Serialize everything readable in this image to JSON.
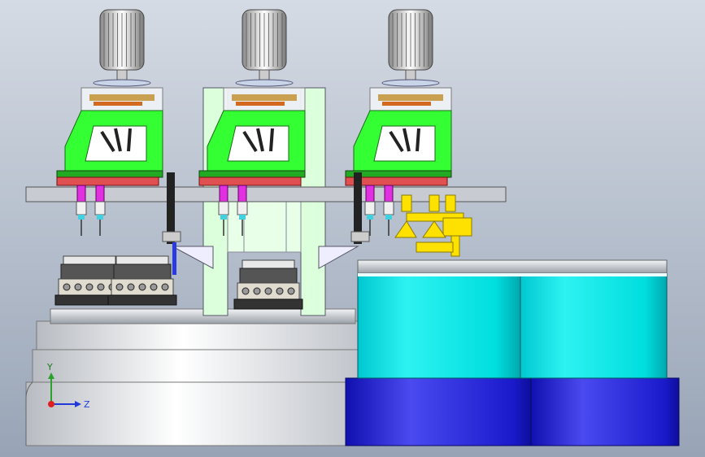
{
  "viewport": {
    "background_top": "#d5dbe4",
    "background_bottom": "#98a4b6"
  },
  "colors": {
    "frame_green": "#33ff33",
    "frame_light_green": "#dcffdc",
    "flange_red": "#e05050",
    "blue_cylinder": "#1a1acc",
    "cyan_drum": "#00e6e6",
    "yellow_fixture": "#ffe100",
    "magenta_spindle": "#e030e0",
    "grey_metal": "#c8ccd2"
  },
  "heads": [
    {
      "name": "drill-head-left"
    },
    {
      "name": "drill-head-center"
    },
    {
      "name": "drill-head-right"
    }
  ],
  "triad": {
    "y_label": "Y",
    "z_label": "Z"
  }
}
